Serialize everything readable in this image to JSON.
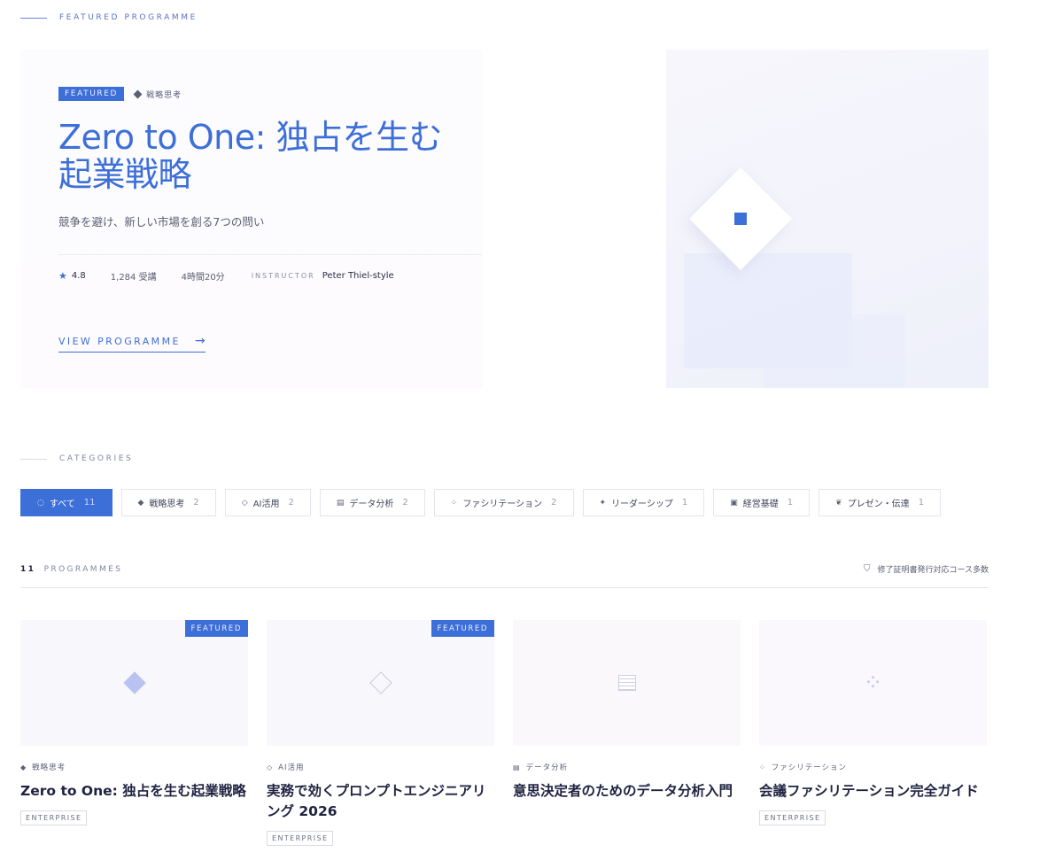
{
  "featured_section": {
    "eyebrow": "FEATURED PROGRAMME"
  },
  "hero": {
    "badge": "FEATURED",
    "category": "戦略思考",
    "title_line1": "Zero to One: 独占を生む",
    "title_line2": "起業戦略",
    "subtitle": "競争を避け、新しい市場を創る7つの問い",
    "rating": "4.8",
    "enrollments": "1,284 受講",
    "duration": "4時間20分",
    "instructor_label": "INSTRUCTOR",
    "instructor_name": "Peter Thiel-style",
    "cta": "VIEW PROGRAMME",
    "icons": {
      "rating": "star-icon",
      "category": "diamond-icon",
      "cta": "arrow-right-icon"
    }
  },
  "categories_section": {
    "eyebrow": "CATEGORIES",
    "chips": [
      {
        "icon": "◌",
        "label": "すべて",
        "count": "11",
        "active": true
      },
      {
        "icon": "◆",
        "label": "戦略思考",
        "count": "2"
      },
      {
        "icon": "◇",
        "label": "AI活用",
        "count": "2"
      },
      {
        "icon": "▤",
        "label": "データ分析",
        "count": "2"
      },
      {
        "icon": "⁘",
        "label": "ファシリテーション",
        "count": "2"
      },
      {
        "icon": "✦",
        "label": "リーダーシップ",
        "count": "1"
      },
      {
        "icon": "▣",
        "label": "経営基礎",
        "count": "1"
      },
      {
        "icon": "❦",
        "label": "プレゼン・伝達",
        "count": "1"
      }
    ]
  },
  "programmes": {
    "count": "11",
    "count_label": "PROGRAMMES",
    "cert_note": "修了証明書発行対応コース多数",
    "cards": [
      {
        "badge": "FEATURED",
        "category_icon": "◆",
        "category": "戦略思考",
        "title": "Zero to One: 独占を生む起業戦略",
        "tag": "ENTERPRISE"
      },
      {
        "badge": "FEATURED",
        "category_icon": "◇",
        "category": "AI活用",
        "title": "実務で効くプロンプトエンジニアリング 2026",
        "tag": "ENTERPRISE"
      },
      {
        "badge": "",
        "category_icon": "▤",
        "category": "データ分析",
        "title": "意思決定者のためのデータ分析入門",
        "tag": ""
      },
      {
        "badge": "",
        "category_icon": "⁘",
        "category": "ファシリテーション",
        "title": "会議ファシリテーション完全ガイド",
        "tag": "ENTERPRISE"
      }
    ]
  },
  "colors": {
    "accent": "#3d6fd8",
    "text": "#1f2340",
    "muted": "#7f86a3"
  }
}
